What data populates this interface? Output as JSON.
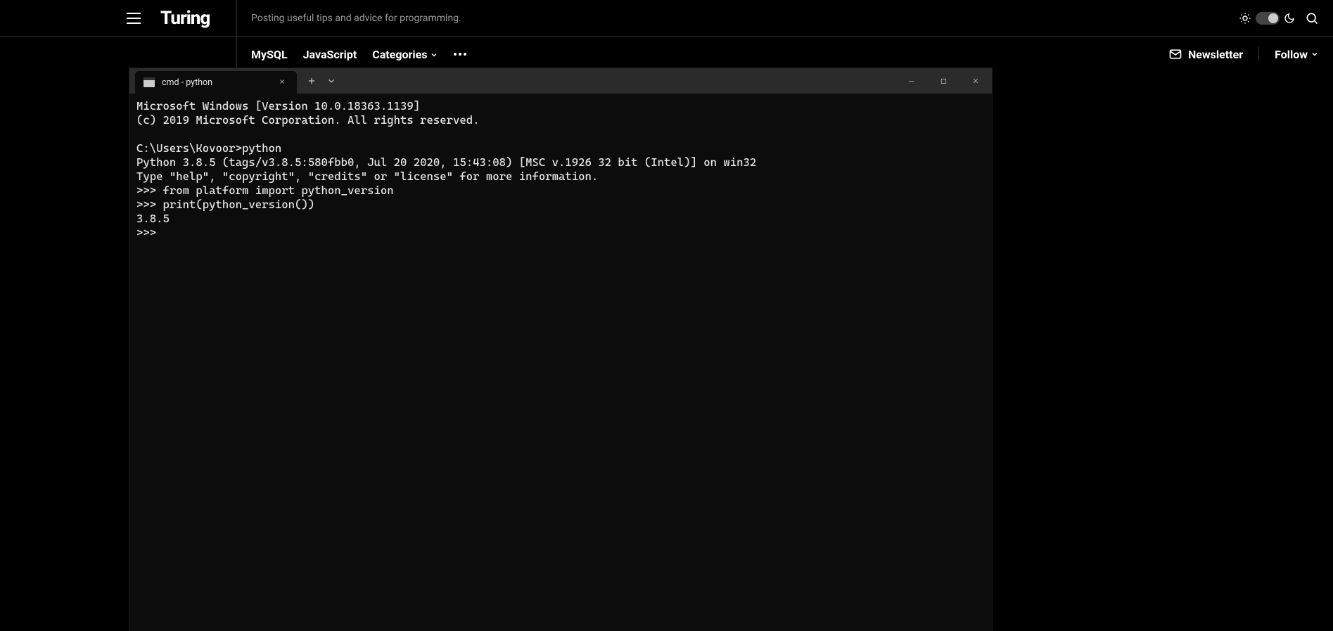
{
  "site": {
    "logo": "Turing",
    "tagline": "Posting useful tips and advice for programming."
  },
  "nav": {
    "links": [
      "MySQL",
      "JavaScript"
    ],
    "categories_label": "Categories",
    "newsletter_label": "Newsletter",
    "follow_label": "Follow"
  },
  "terminal": {
    "tab_title": "cmd - python",
    "lines": [
      "Microsoft Windows [Version 10.0.18363.1139]",
      "(c) 2019 Microsoft Corporation. All rights reserved.",
      "",
      "C:\\Users\\Kovoor>python",
      "Python 3.8.5 (tags/v3.8.5:580fbb0, Jul 20 2020, 15:43:08) [MSC v.1926 32 bit (Intel)] on win32",
      "Type \"help\", \"copyright\", \"credits\" or \"license\" for more information.",
      ">>> from platform import python_version",
      ">>> print(python_version())",
      "3.8.5",
      ">>> "
    ]
  }
}
